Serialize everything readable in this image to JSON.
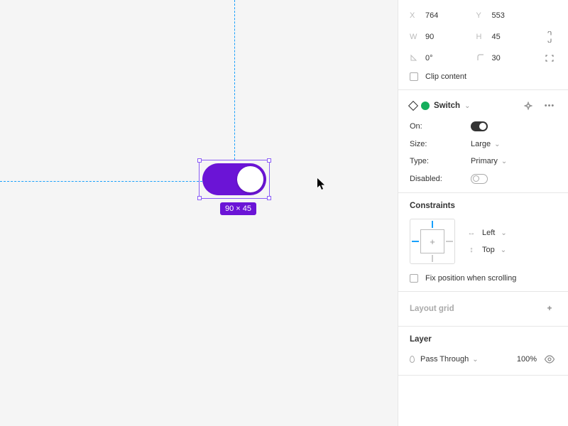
{
  "canvas": {
    "selection_badge": "90 × 45",
    "switch_color": "#6b14d6"
  },
  "transform": {
    "x_label": "X",
    "x_value": "764",
    "y_label": "Y",
    "y_value": "553",
    "w_label": "W",
    "w_value": "90",
    "h_label": "H",
    "h_value": "45",
    "rotation_value": "0°",
    "corner_radius_value": "30",
    "clip_content_label": "Clip content"
  },
  "component": {
    "name": "Switch",
    "props": {
      "on": {
        "label": "On:",
        "value": true
      },
      "size": {
        "label": "Size:",
        "value": "Large"
      },
      "type": {
        "label": "Type:",
        "value": "Primary"
      },
      "disabled": {
        "label": "Disabled:",
        "value": false
      }
    }
  },
  "constraints": {
    "title": "Constraints",
    "horizontal": "Left",
    "vertical": "Top",
    "fix_position_label": "Fix position when scrolling"
  },
  "layout_grid": {
    "title": "Layout grid"
  },
  "layer": {
    "title": "Layer",
    "blend_mode": "Pass Through",
    "opacity": "100%"
  }
}
